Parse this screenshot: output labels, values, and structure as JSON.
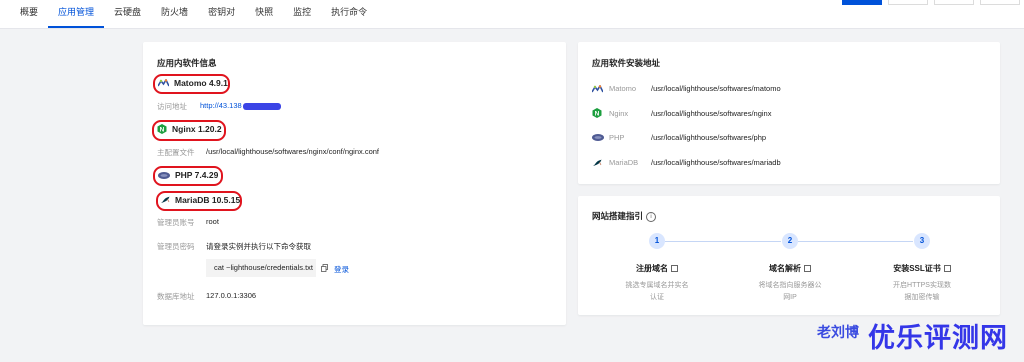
{
  "tabs": [
    "概要",
    "应用管理",
    "云硬盘",
    "防火墙",
    "密钥对",
    "快照",
    "监控",
    "执行命令"
  ],
  "active_tab": "应用管理",
  "app_info": {
    "title": "应用内软件信息",
    "matomo": {
      "name": "Matomo 4.9.1",
      "url_label": "访问地址",
      "url_value": "http://43.138"
    },
    "nginx": {
      "name": "Nginx 1.20.2",
      "conf_label": "主配置文件",
      "conf_value": "/usr/local/lighthouse/softwares/nginx/conf/nginx.conf"
    },
    "php": {
      "name": "PHP 7.4.29"
    },
    "mariadb": {
      "name": "MariaDB 10.5.15",
      "admin_label": "管理员账号",
      "admin_value": "root",
      "pwd_label": "管理员密码",
      "pwd_value": "请登录实例并执行以下命令获取",
      "cmd": "cat ~lighthouse/credentials.txt",
      "login_link": "登录",
      "db_label": "数据库地址",
      "db_value": "127.0.0.1:3306"
    }
  },
  "install_paths": {
    "title": "应用软件安装地址",
    "rows": [
      {
        "name": "Matomo",
        "path": "/usr/local/lighthouse/softwares/matomo",
        "icon": "matomo-icon"
      },
      {
        "name": "Nginx",
        "path": "/usr/local/lighthouse/softwares/nginx",
        "icon": "nginx-icon"
      },
      {
        "name": "PHP",
        "path": "/usr/local/lighthouse/softwares/php",
        "icon": "php-icon"
      },
      {
        "name": "MariaDB",
        "path": "/usr/local/lighthouse/softwares/mariadb",
        "icon": "mariadb-icon"
      }
    ]
  },
  "guide": {
    "title": "网站搭建指引",
    "steps": [
      {
        "num": "1",
        "title": "注册域名",
        "desc1": "挑选专属域名并实名",
        "desc2": "认证"
      },
      {
        "num": "2",
        "title": "域名解析",
        "desc1": "将域名指向服务器公",
        "desc2": "网IP"
      },
      {
        "num": "3",
        "title": "安装SSL证书",
        "desc1": "开启HTTPS实现数",
        "desc2": "据加密传输"
      }
    ]
  },
  "watermark": {
    "small": "老刘博",
    "large": "优乐评测网"
  },
  "colors": {
    "accent": "#0052d9",
    "highlight_ring": "#e0141e",
    "nginx_green": "#1b9e3e"
  }
}
